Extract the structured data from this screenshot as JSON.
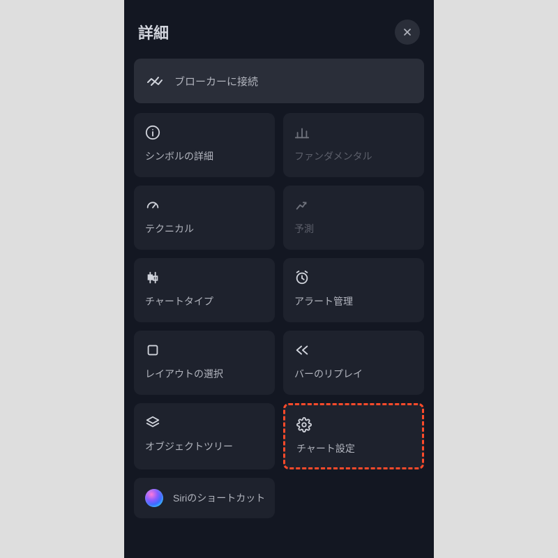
{
  "header": {
    "title": "詳細"
  },
  "broker": {
    "label": "ブローカーに接続"
  },
  "cards": {
    "symbol_detail": "シンボルの詳細",
    "fundamental": "ファンダメンタル",
    "technical": "テクニカル",
    "forecast": "予測",
    "chart_type": "チャートタイプ",
    "alert_manage": "アラート管理",
    "layout_select": "レイアウトの選択",
    "bar_replay": "バーのリプレイ",
    "object_tree": "オブジェクトツリー",
    "chart_settings": "チャート設定"
  },
  "shortcut": {
    "label": "Siriのショートカット"
  }
}
